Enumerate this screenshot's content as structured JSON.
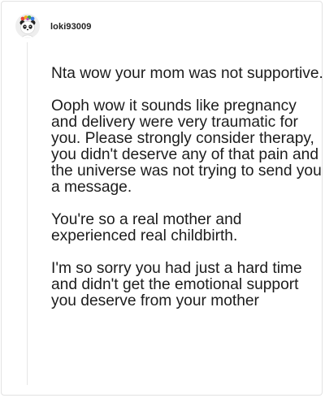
{
  "comment": {
    "author": {
      "username": "loki93009",
      "avatar_icon": "panda-avatar-icon"
    },
    "paragraphs": [
      "Nta wow your mom was not supportive.",
      "Ooph wow it sounds like pregnancy and delivery were very traumatic for you. Please strongly consider therapy, you didn't deserve any of that pain and the universe was not trying to send you a message.",
      "You're so a real mother and experienced real childbirth.",
      "I'm so sorry you had just a hard time and didn't get the emotional support you deserve from your mother"
    ]
  },
  "colors": {
    "border": "#e2e2e2",
    "thread_line": "#e6e6e6",
    "text": "#1c1c1c"
  }
}
